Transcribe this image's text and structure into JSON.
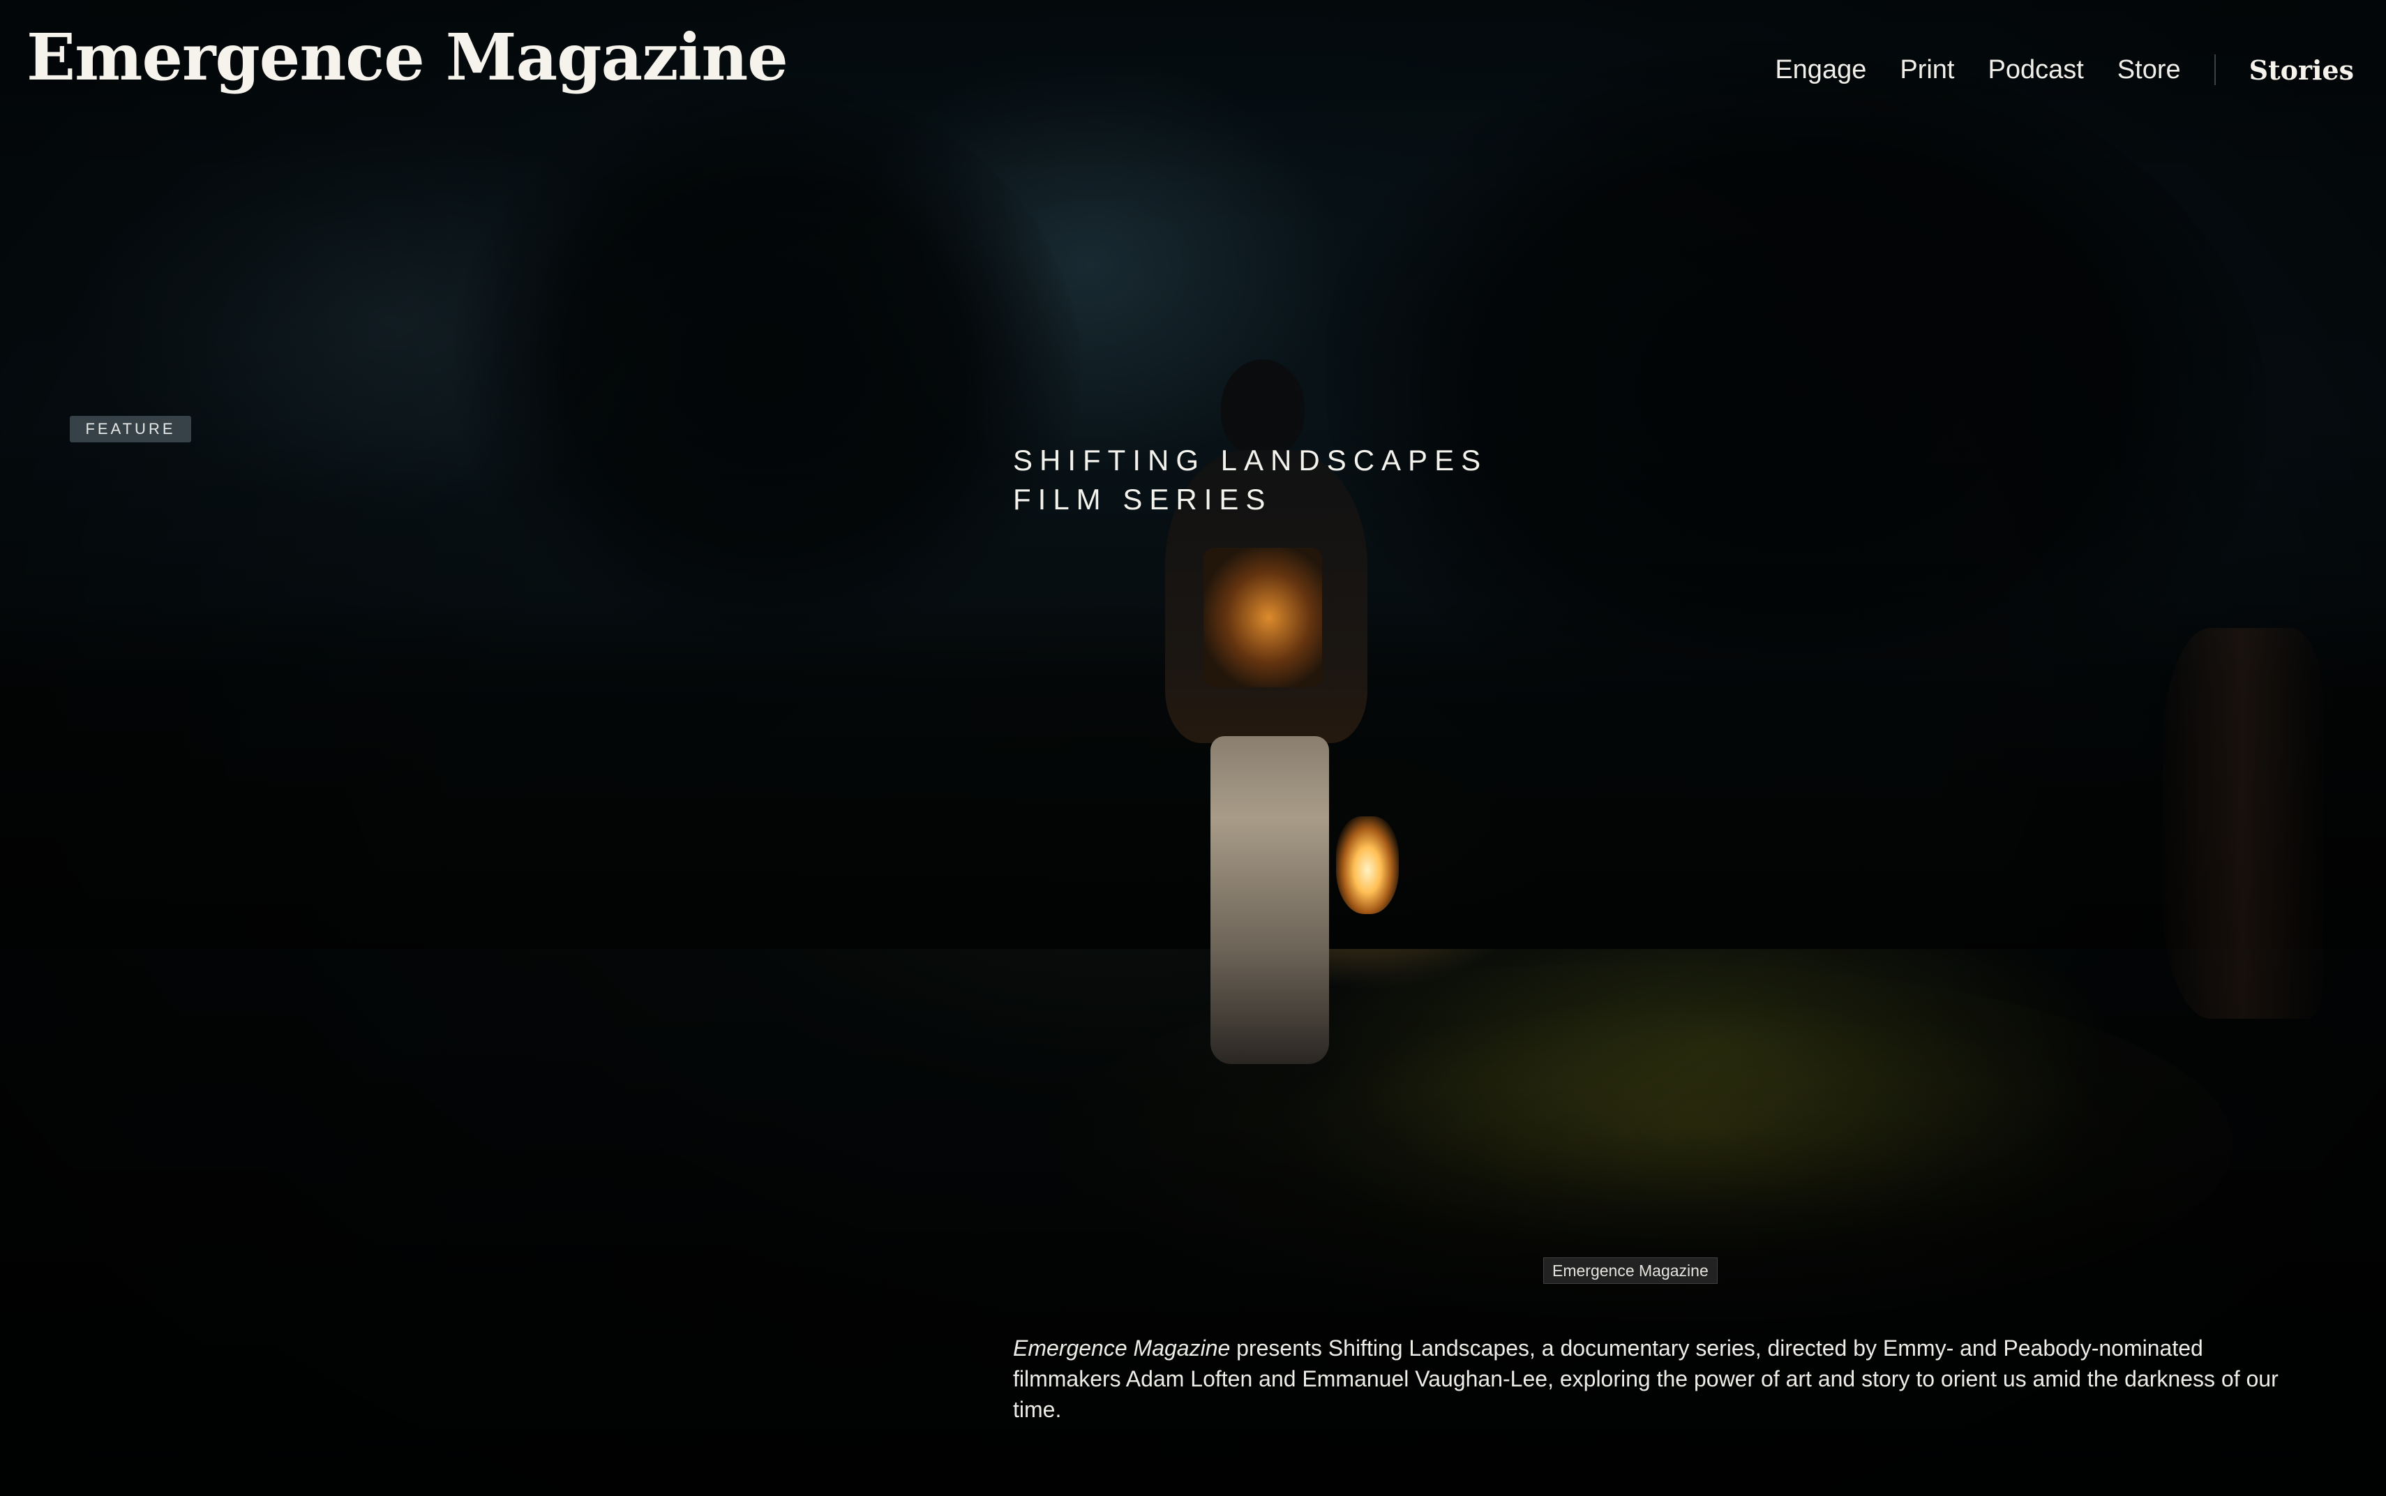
{
  "site": {
    "logo": "Emergence Magazine"
  },
  "nav": {
    "items": [
      {
        "label": "Engage"
      },
      {
        "label": "Print"
      },
      {
        "label": "Podcast"
      },
      {
        "label": "Store"
      }
    ],
    "stories_label": "Stories"
  },
  "hero": {
    "badge": "FEATURE",
    "title_line1": "SHIFTING LANDSCAPES",
    "title_line2": "FILM SERIES",
    "photo_credit": "Emergence Magazine",
    "description_publication": "Emergence Magazine",
    "description_rest": " presents Shifting Landscapes, a documentary series, directed by Emmy- and Peabody-nominated filmmakers Adam Loften and Emmanuel Vaughan-Lee, exploring the power of art and story to orient us amid the darkness of our time."
  },
  "colors": {
    "background": "#030506",
    "text": "#f4f2ec",
    "badge_bg": "#3e4a50",
    "lantern_glow": "#ffbf55"
  }
}
